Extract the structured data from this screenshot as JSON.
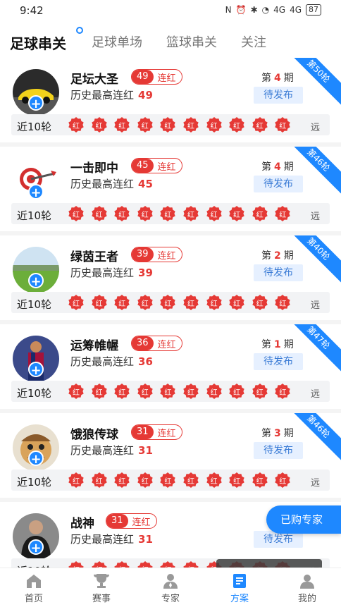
{
  "status_bar": {
    "time": "9:42",
    "battery": "87",
    "signal1": "4G",
    "signal2": "4G"
  },
  "tabs": [
    {
      "label": "足球串关",
      "active": true
    },
    {
      "label": "足球单场",
      "active": false
    },
    {
      "label": "篮球串关",
      "active": false
    },
    {
      "label": "关注",
      "active": false
    }
  ],
  "common": {
    "streak_suffix": "连红",
    "history_label": "历史最高连红",
    "recent_label": "近10轮",
    "period_prefix": "第",
    "period_suffix": "期",
    "pending_label": "待发布",
    "far_label": "远",
    "result_text": "红"
  },
  "experts": [
    {
      "name": "足坛大圣",
      "streak": "49",
      "history_max": "49",
      "period": "4",
      "round_tag": "第50轮",
      "avatar": "sports-car"
    },
    {
      "name": "一击即中",
      "streak": "45",
      "history_max": "45",
      "period": "4",
      "round_tag": "第46轮",
      "avatar": "target-dart"
    },
    {
      "name": "绿茵王者",
      "streak": "39",
      "history_max": "39",
      "period": "2",
      "round_tag": "第40轮",
      "avatar": "green-field"
    },
    {
      "name": "运筹帷幄",
      "streak": "36",
      "history_max": "36",
      "period": "1",
      "round_tag": "第47轮",
      "avatar": "football-player"
    },
    {
      "name": "饿狼传球",
      "streak": "31",
      "history_max": "31",
      "period": "3",
      "round_tag": "第46轮",
      "avatar": "cartoon-face"
    },
    {
      "name": "战神",
      "streak": "31",
      "history_max": "31",
      "period": "",
      "round_tag": "",
      "avatar": "dark-figure"
    }
  ],
  "purchased_button": "已购专家",
  "watermark": "yafusport.com",
  "bottom_nav": [
    {
      "label": "首页",
      "icon": "home-icon",
      "active": false
    },
    {
      "label": "赛事",
      "icon": "trophy-icon",
      "active": false
    },
    {
      "label": "专家",
      "icon": "expert-icon",
      "active": false
    },
    {
      "label": "方案",
      "icon": "plan-icon",
      "active": true
    },
    {
      "label": "我的",
      "icon": "profile-icon",
      "active": false
    }
  ],
  "colors": {
    "accent": "#1e88ff",
    "red": "#e53935"
  }
}
